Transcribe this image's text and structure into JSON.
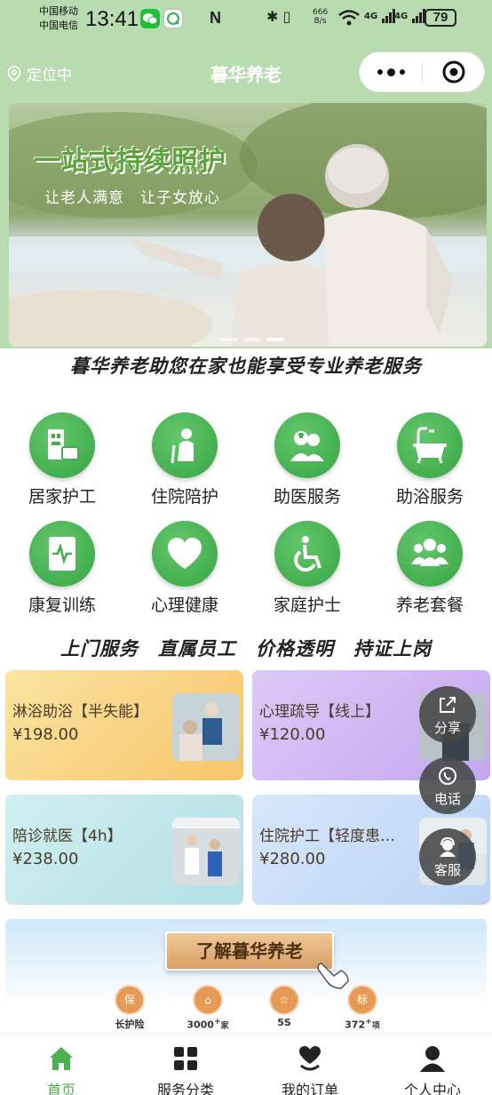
{
  "status_bar": {
    "carrier_1": "中国移动",
    "carrier_2": "中国电信",
    "time": "13:41",
    "nfc": "N",
    "net_speed_value": "666",
    "net_speed_unit": "B/s",
    "signal_1": "4G",
    "signal_2": "4G",
    "battery": "79"
  },
  "nav": {
    "location": "定位中",
    "title": "暮华养老"
  },
  "banner": {
    "headline": "一站式持续照护",
    "subline": "让老人满意　让子女放心",
    "active_slide": 3,
    "slide_count": 3
  },
  "slogan_1": "暮华养老助您在家也能享受专业养老服务",
  "services": [
    {
      "label": "居家护工",
      "icon": "home-care-icon"
    },
    {
      "label": "住院陪护",
      "icon": "elderly-escort-icon"
    },
    {
      "label": "助医服务",
      "icon": "medical-staff-icon"
    },
    {
      "label": "助浴服务",
      "icon": "bathtub-icon"
    },
    {
      "label": "康复训练",
      "icon": "heartbeat-icon"
    },
    {
      "label": "心理健康",
      "icon": "heart-icon"
    },
    {
      "label": "家庭护士",
      "icon": "wheelchair-icon"
    },
    {
      "label": "养老套餐",
      "icon": "group-icon"
    }
  ],
  "slogan_2": "上门服务　直属员工　价格透明　持证上岗",
  "products": [
    {
      "name": "淋浴助浴【半失能】",
      "price": "¥198.00"
    },
    {
      "name": "心理疏导【线上】",
      "price": "¥120.00"
    },
    {
      "name": "陪诊就医【4h】",
      "price": "¥238.00"
    },
    {
      "name": "住院护工【轻度患…",
      "price": "¥280.00"
    }
  ],
  "floating": {
    "share": "分享",
    "phone": "电话",
    "service": "客服"
  },
  "promo": {
    "button": "了解暮华养老",
    "badges": [
      {
        "icon_text": "保",
        "label": "长护险"
      },
      {
        "icon_text": "⌂",
        "label": "3000",
        "sup": "+",
        "suffix": "家"
      },
      {
        "icon_text": "☆",
        "label": "5S"
      },
      {
        "icon_text": "标",
        "label": "372",
        "sup": "+",
        "suffix": "项"
      }
    ]
  },
  "tabbar": [
    {
      "label": "首页",
      "icon": "home-icon"
    },
    {
      "label": "服务分类",
      "icon": "category-icon"
    },
    {
      "label": "我的订单",
      "icon": "order-heart-icon"
    },
    {
      "label": "个人中心",
      "icon": "user-icon"
    }
  ],
  "colors": {
    "header_green": "#b8dbb0",
    "icon_green": "#43ad4f",
    "active_tab": "#4caf50"
  }
}
